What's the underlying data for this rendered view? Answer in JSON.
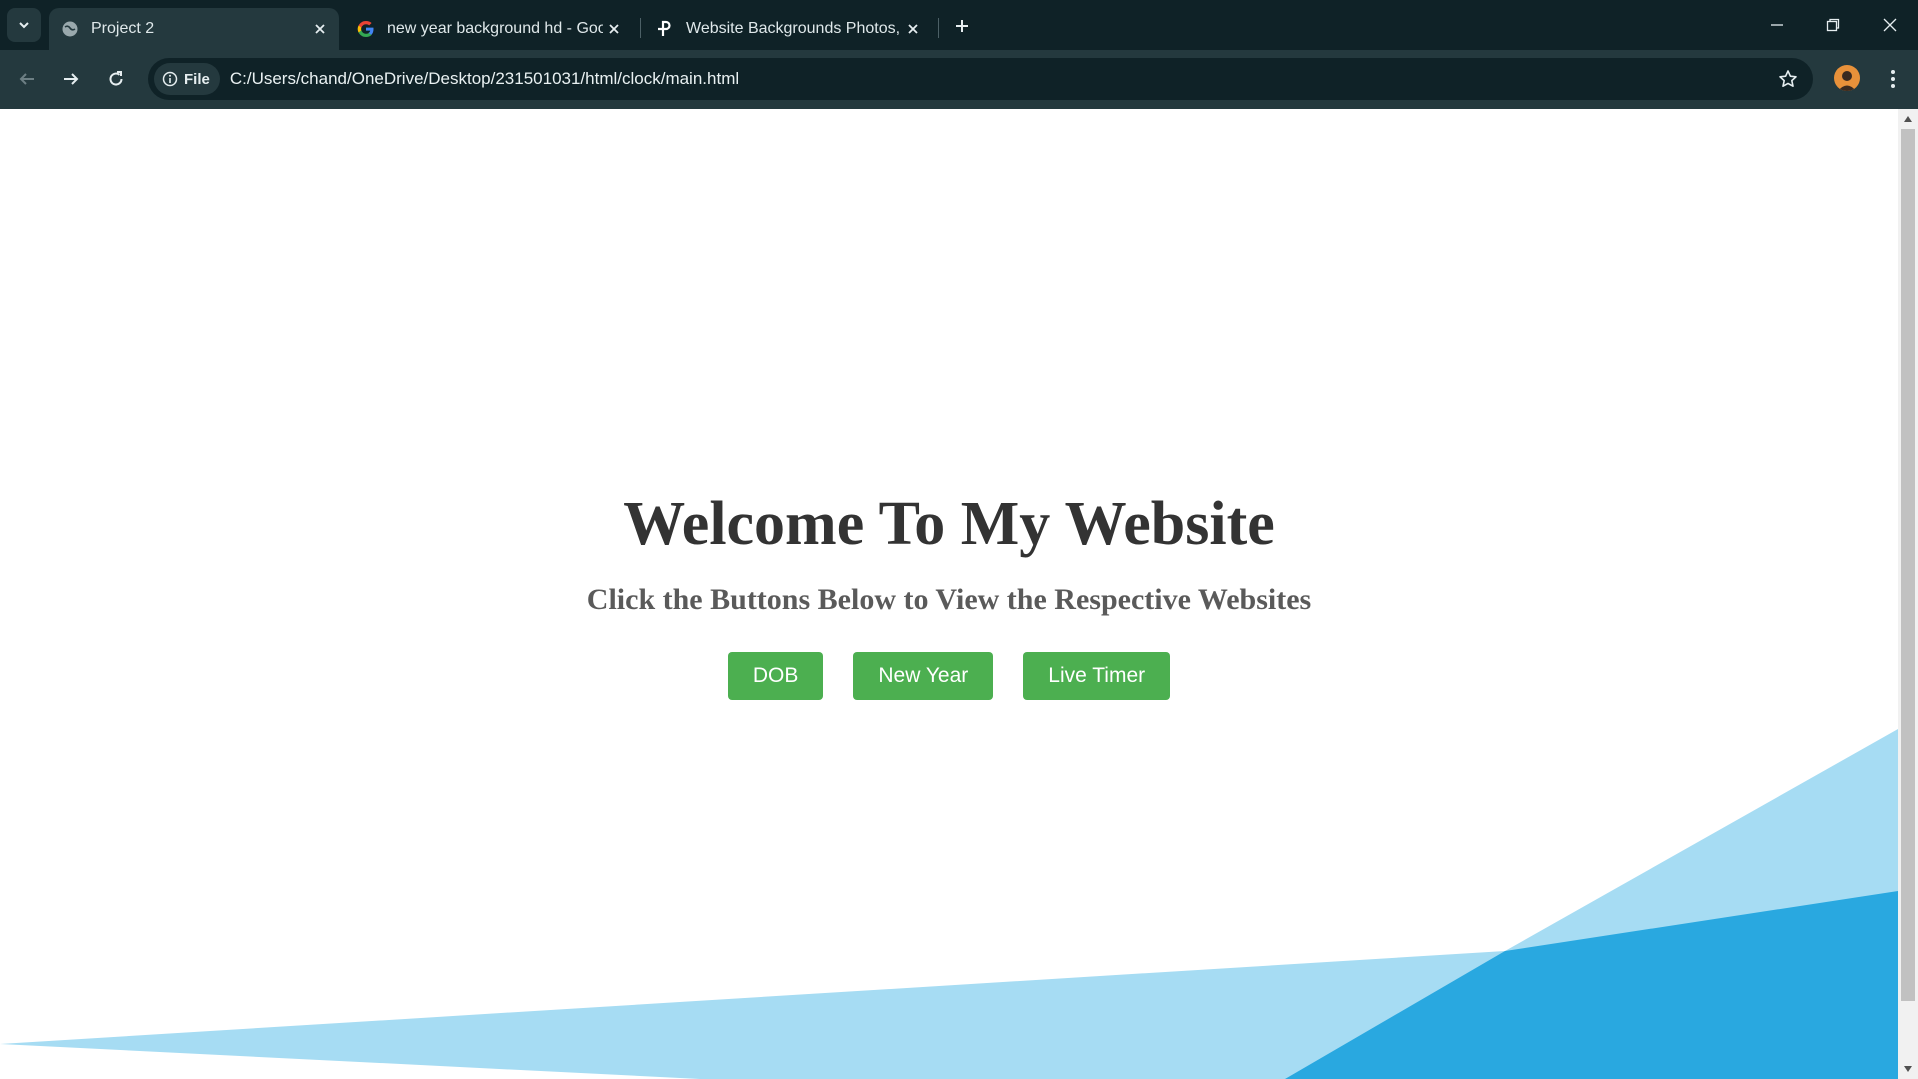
{
  "browser": {
    "tabs": [
      {
        "title": "Project 2",
        "favicon": "globe-icon",
        "active": true
      },
      {
        "title": "new year background hd - Goo",
        "favicon": "google-icon",
        "active": false
      },
      {
        "title": "Website Backgrounds Photos, D",
        "favicon": "pexels-icon",
        "active": false
      }
    ],
    "site_info_label": "File",
    "url": "C:/Users/chand/OneDrive/Desktop/231501031/html/clock/main.html"
  },
  "page": {
    "heading": "Welcome To My Website",
    "subheading": "Click the Buttons Below to View the Respective Websites",
    "buttons": [
      {
        "label": "DOB"
      },
      {
        "label": "New Year"
      },
      {
        "label": "Live Timer"
      }
    ]
  },
  "colors": {
    "button": "#4caf50",
    "shape_light": "#a6dcf3",
    "shape_dark": "#29a8e0"
  }
}
